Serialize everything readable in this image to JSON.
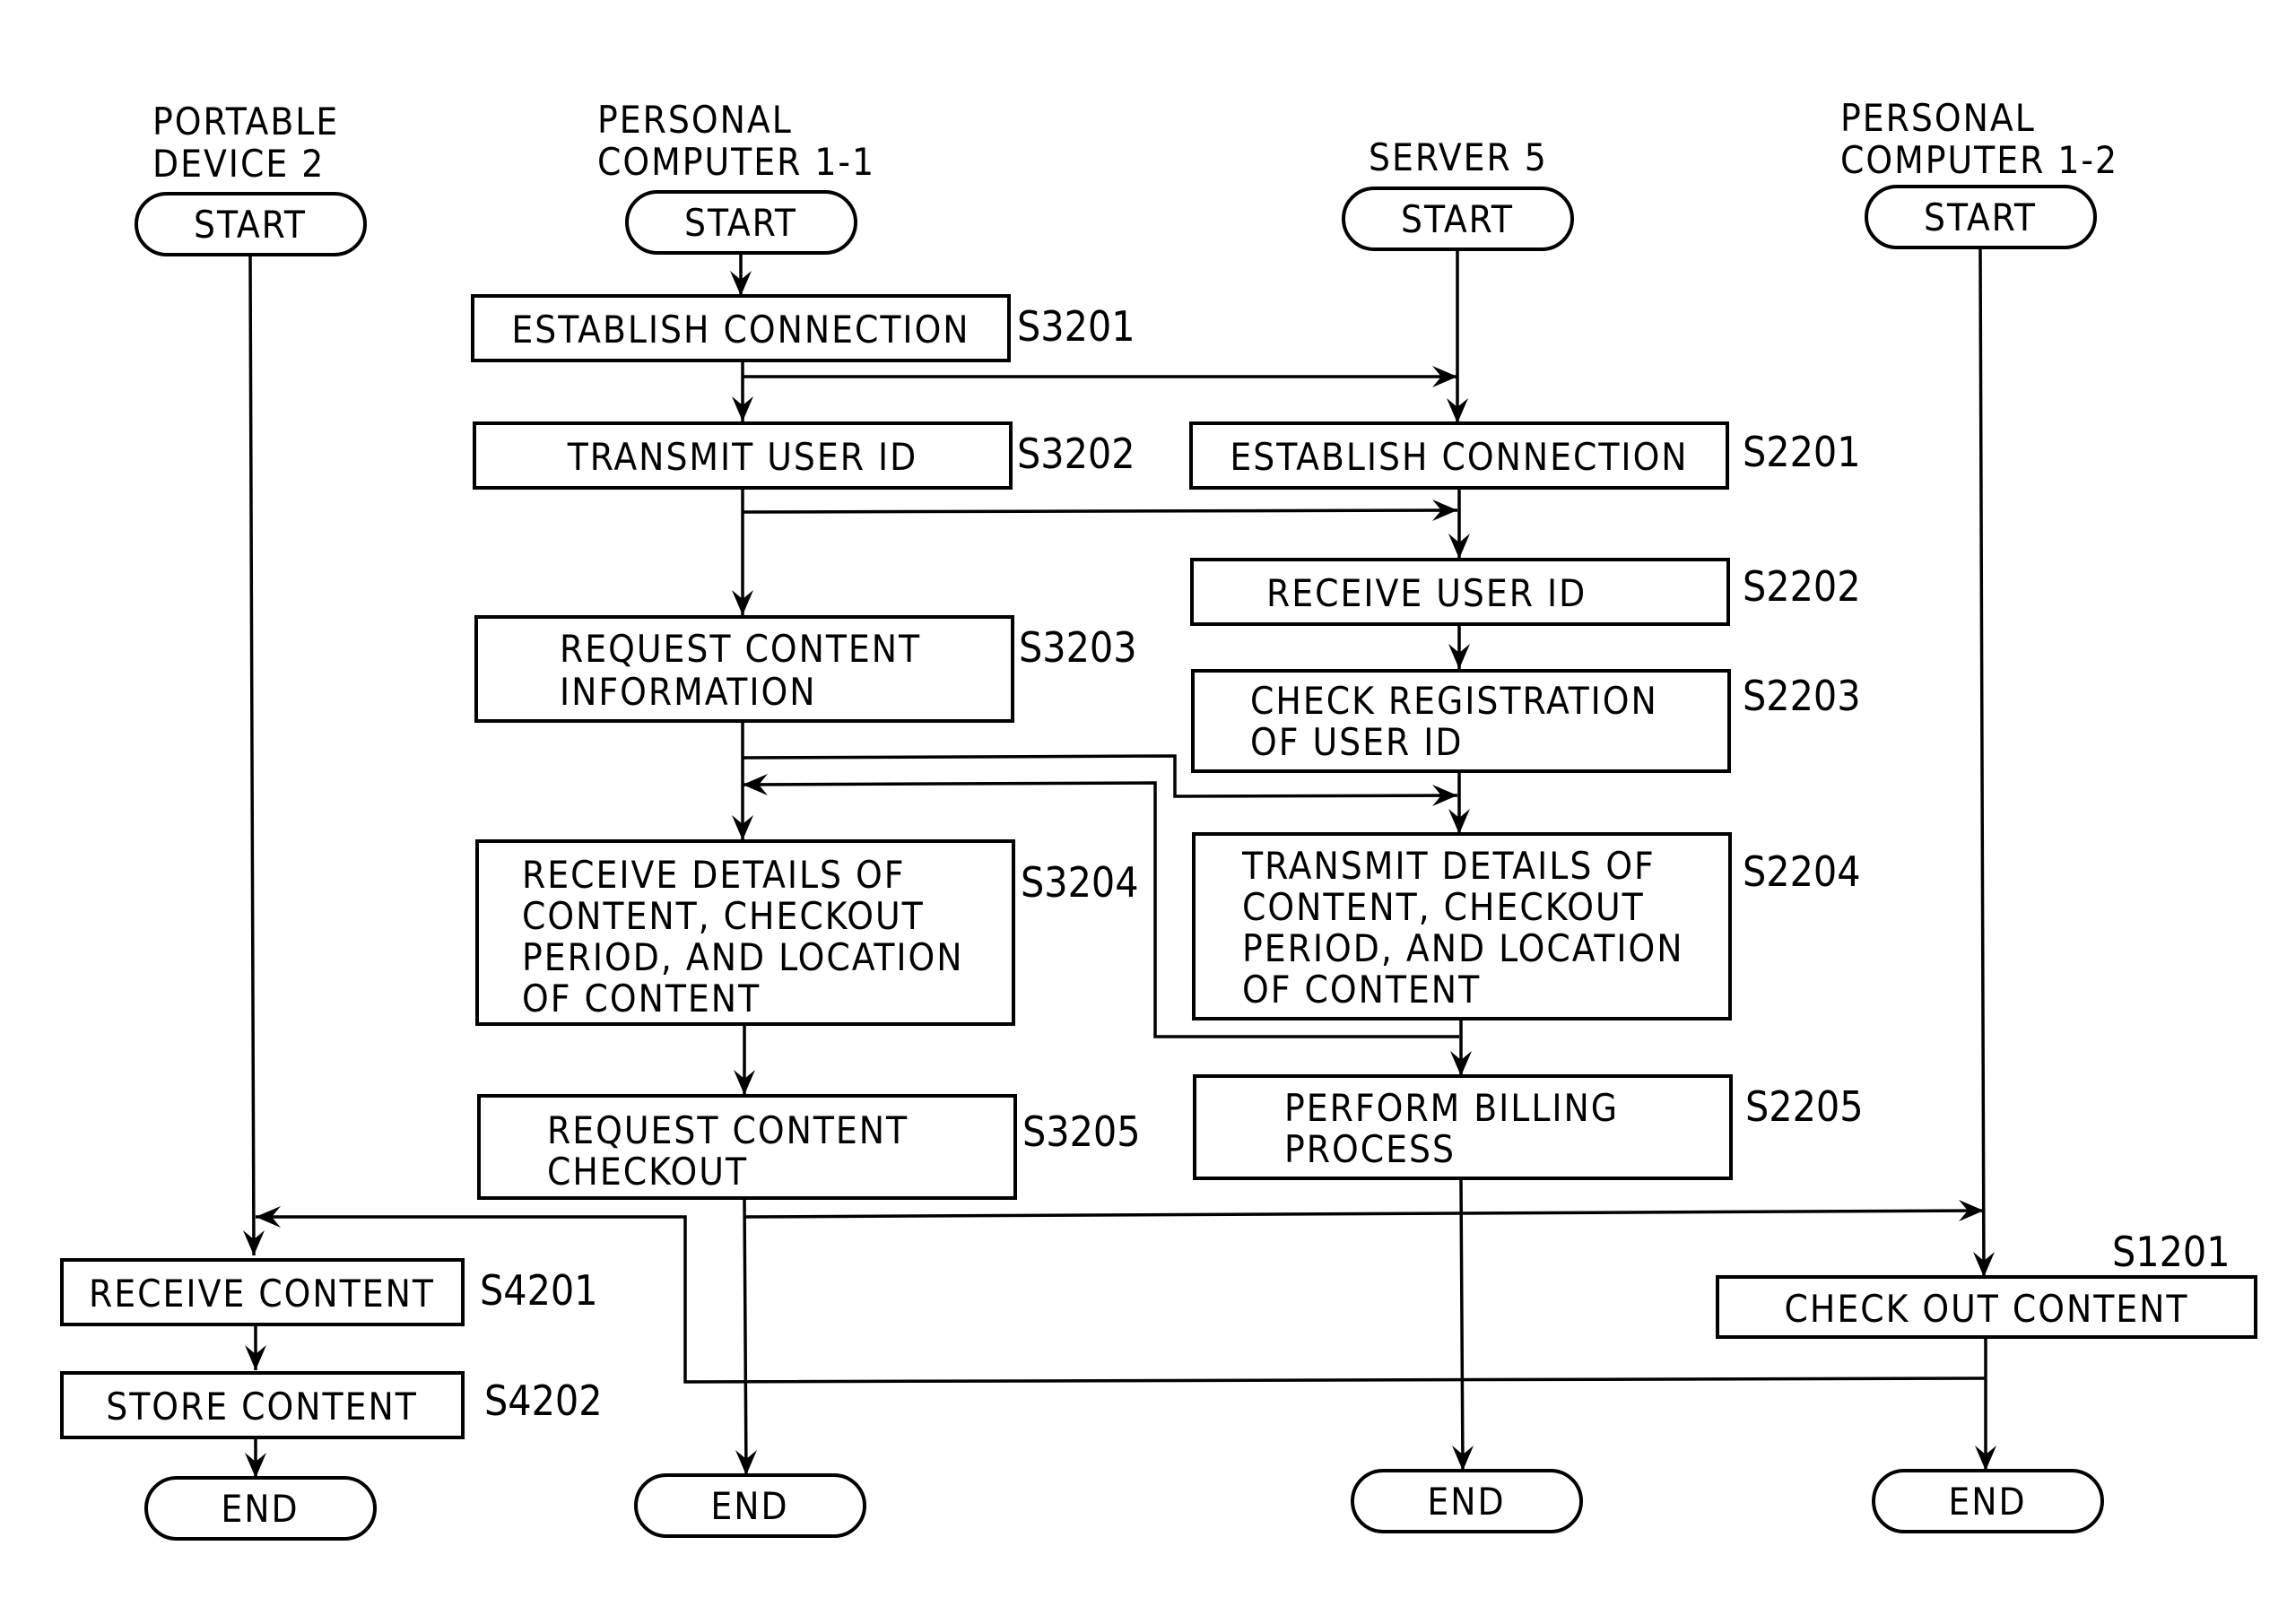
{
  "diagram": {
    "type": "flowchart-swimlane",
    "lanes": [
      {
        "id": "pd",
        "title_line1": "PORTABLE",
        "title_line2": "DEVICE 2"
      },
      {
        "id": "pc1",
        "title_line1": "PERSONAL",
        "title_line2": "COMPUTER 1-1"
      },
      {
        "id": "srv",
        "title_line1": "",
        "title_line2": "SERVER 5"
      },
      {
        "id": "pc2",
        "title_line1": "PERSONAL",
        "title_line2": "COMPUTER 1-2"
      }
    ],
    "terminals": {
      "start": "START",
      "end": "END"
    },
    "steps": {
      "S3201": {
        "id": "S3201",
        "lines": [
          "ESTABLISH CONNECTION"
        ]
      },
      "S3202": {
        "id": "S3202",
        "lines": [
          "TRANSMIT USER ID"
        ]
      },
      "S3203": {
        "id": "S3203",
        "lines": [
          "REQUEST CONTENT",
          "INFORMATION"
        ]
      },
      "S3204": {
        "id": "S3204",
        "lines": [
          "RECEIVE DETAILS OF",
          "CONTENT, CHECKOUT",
          "PERIOD, AND LOCATION",
          "OF CONTENT"
        ]
      },
      "S3205": {
        "id": "S3205",
        "lines": [
          "REQUEST CONTENT",
          "CHECKOUT"
        ]
      },
      "S2201": {
        "id": "S2201",
        "lines": [
          "ESTABLISH CONNECTION"
        ]
      },
      "S2202": {
        "id": "S2202",
        "lines": [
          "RECEIVE USER ID"
        ]
      },
      "S2203": {
        "id": "S2203",
        "lines": [
          "CHECK REGISTRATION",
          "OF USER ID"
        ]
      },
      "S2204": {
        "id": "S2204",
        "lines": [
          "TRANSMIT DETAILS OF",
          "CONTENT, CHECKOUT",
          "PERIOD, AND LOCATION",
          "OF CONTENT"
        ]
      },
      "S2205": {
        "id": "S2205",
        "lines": [
          "PERFORM BILLING",
          "PROCESS"
        ]
      },
      "S4201": {
        "id": "S4201",
        "lines": [
          "RECEIVE CONTENT"
        ]
      },
      "S4202": {
        "id": "S4202",
        "lines": [
          "STORE CONTENT"
        ]
      },
      "S1201": {
        "id": "S1201",
        "lines": [
          "CHECK OUT CONTENT"
        ]
      }
    },
    "connections": [
      {
        "from": "S3201",
        "to": "S2201"
      },
      {
        "from": "S3202",
        "to": "S2202"
      },
      {
        "from": "S3203",
        "to": "S2204"
      },
      {
        "from": "S2204",
        "to": "S3204"
      },
      {
        "from": "S3205",
        "to": "S1201"
      },
      {
        "from": "S1201",
        "to": "S4201"
      }
    ]
  }
}
